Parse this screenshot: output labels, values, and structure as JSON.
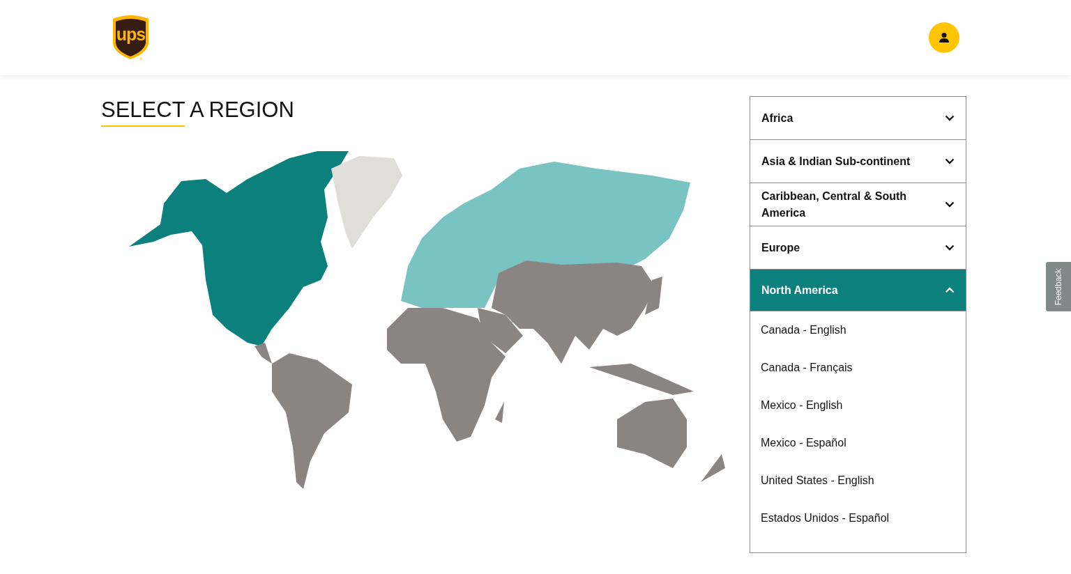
{
  "header": {
    "logo_text": "ups",
    "logo_mark": "®"
  },
  "heading": "SELECT A REGION",
  "map": {
    "regions": [
      {
        "kind": "north-america",
        "color": "#0b807d"
      },
      {
        "kind": "greenland",
        "color": "#e0dedb"
      },
      {
        "kind": "europe",
        "color": "#79c3c3"
      },
      {
        "kind": "asia",
        "color": "#8a8483"
      },
      {
        "kind": "africa",
        "color": "#8a8483"
      },
      {
        "kind": "south-america",
        "color": "#8a8483"
      },
      {
        "kind": "oceania",
        "color": "#8a8483"
      }
    ]
  },
  "regions": [
    {
      "label": "Africa",
      "expanded": false
    },
    {
      "label": "Asia & Indian Sub-continent",
      "expanded": false
    },
    {
      "label": "Caribbean, Central & South America",
      "expanded": false
    },
    {
      "label": "Europe",
      "expanded": false
    },
    {
      "label": "North America",
      "expanded": true,
      "countries": [
        "Canada - English",
        "Canada - Français",
        "Mexico - English",
        "Mexico - Español",
        "United States - English",
        "Estados Unidos - Español"
      ]
    }
  ],
  "feedback": "Feedback"
}
